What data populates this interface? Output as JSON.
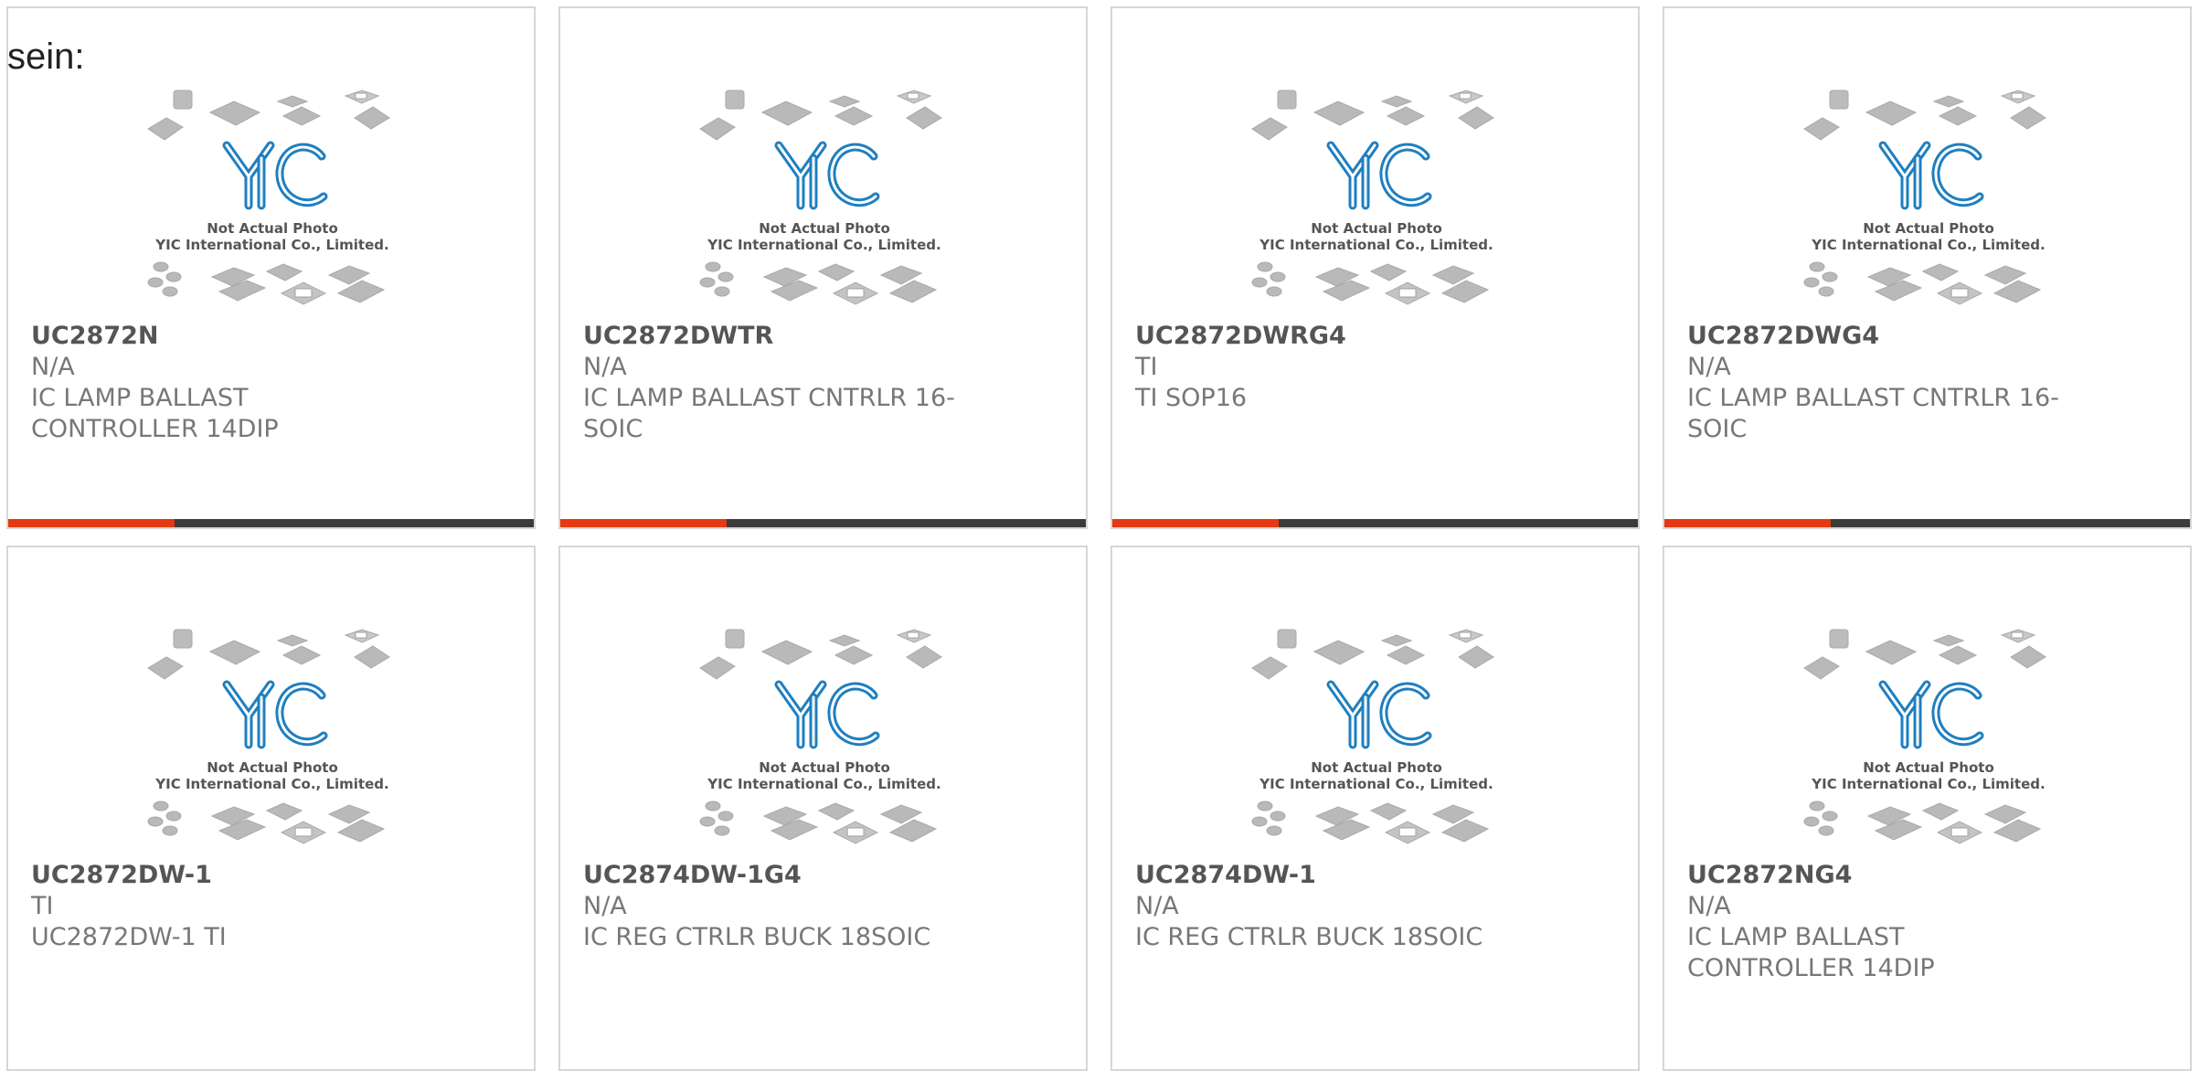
{
  "intro_text": "sein:",
  "colors": {
    "accent": "#e23a12",
    "bar_dark": "#3b3b3b",
    "logo_blue": "#1e7fc0",
    "chip_gray": "#b9b9b9"
  },
  "placeholder": {
    "logo_text": "YIC",
    "line1": "Not Actual Photo",
    "line2": "YIC International Co., Limited."
  },
  "products": [
    {
      "part": "UC2872N",
      "manufacturer": "N/A",
      "description": "IC LAMP BALLAST CONTROLLER 14DIP"
    },
    {
      "part": "UC2872DWTR",
      "manufacturer": "N/A",
      "description": "IC LAMP BALLAST CNTRLR 16-SOIC"
    },
    {
      "part": "UC2872DWRG4",
      "manufacturer": "TI",
      "description": "TI SOP16"
    },
    {
      "part": "UC2872DWG4",
      "manufacturer": "N/A",
      "description": "IC LAMP BALLAST CNTRLR 16-SOIC"
    },
    {
      "part": "UC2872DW-1",
      "manufacturer": "TI",
      "description": "UC2872DW-1 TI"
    },
    {
      "part": "UC2874DW-1G4",
      "manufacturer": "N/A",
      "description": "IC REG CTRLR BUCK 18SOIC"
    },
    {
      "part": "UC2874DW-1",
      "manufacturer": "N/A",
      "description": "IC REG CTRLR BUCK 18SOIC"
    },
    {
      "part": "UC2872NG4",
      "manufacturer": "N/A",
      "description": "IC LAMP BALLAST CONTROLLER 14DIP"
    }
  ]
}
